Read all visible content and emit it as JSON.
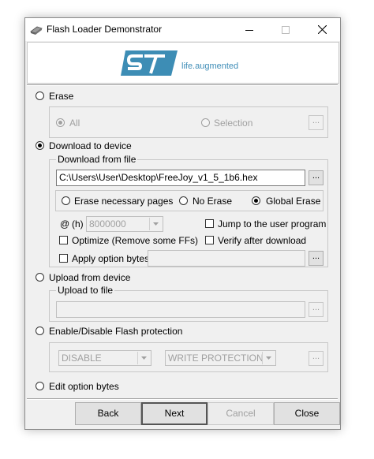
{
  "window": {
    "title": "Flash Loader Demonstrator"
  },
  "banner": {
    "tagline": "life.augmented"
  },
  "erase": {
    "label": "Erase",
    "all_label": "All",
    "selection_label": "Selection",
    "browse_label": "..."
  },
  "download": {
    "label": "Download to device",
    "group_label": "Download from file",
    "file_path": "C:\\Users\\User\\Desktop\\FreeJoy_v1_5_1b6.hex",
    "browse_label": "...",
    "erase_options": [
      "Erase necessary pages",
      "No Erase",
      "Global Erase"
    ],
    "selected_erase_option": "Global Erase",
    "address_prefix": "@",
    "address_unit": "(h)",
    "address_value": "8000000",
    "jump_label": "Jump to the user program",
    "optimize_label": "Optimize (Remove some FFs)",
    "verify_label": "Verify after download",
    "apply_option_label": "Apply option bytes",
    "apply_browse_label": "..."
  },
  "upload": {
    "label": "Upload from device",
    "group_label": "Upload to file",
    "browse_label": "..."
  },
  "protection": {
    "label": "Enable/Disable Flash protection",
    "mode_value": "DISABLE",
    "type_value": "WRITE PROTECTION",
    "browse_label": "..."
  },
  "edit_option": {
    "label": "Edit option bytes"
  },
  "footer": {
    "back": "Back",
    "next": "Next",
    "cancel": "Cancel",
    "close": "Close"
  }
}
